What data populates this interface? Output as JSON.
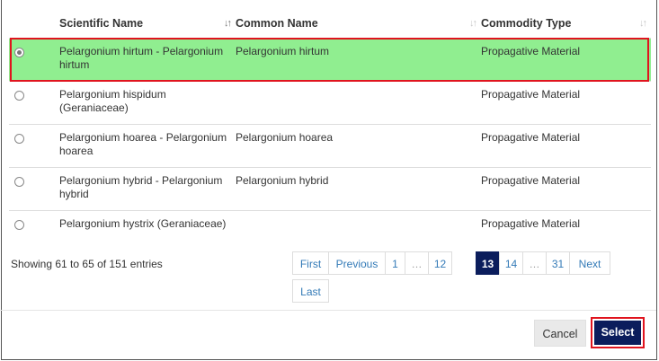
{
  "table": {
    "headers": {
      "scientific_name": "Scientific Name",
      "common_name": "Common Name",
      "commodity_type": "Commodity Type"
    },
    "rows": [
      {
        "scientific": "Pelargonium hirtum - Pelargonium hirtum",
        "common": "Pelargonium hirtum",
        "commodity": "Propagative Material",
        "selected": true
      },
      {
        "scientific": "Pelargonium hispidum (Geraniaceae)",
        "common": "",
        "commodity": "Propagative Material",
        "selected": false
      },
      {
        "scientific": "Pelargonium hoarea - Pelargonium hoarea",
        "common": "Pelargonium hoarea",
        "commodity": "Propagative Material",
        "selected": false
      },
      {
        "scientific": "Pelargonium hybrid - Pelargonium hybrid",
        "common": "Pelargonium hybrid",
        "commodity": "Propagative Material",
        "selected": false
      },
      {
        "scientific": "Pelargonium hystrix (Geraniaceae)",
        "common": "",
        "commodity": "Propagative Material",
        "selected": false
      }
    ]
  },
  "info": "Showing 61 to 65 of 151 entries",
  "pagination": {
    "first": "First",
    "previous": "Previous",
    "pages": [
      "1",
      "…",
      "12",
      "13",
      "14",
      "…",
      "31"
    ],
    "current_page": "13",
    "next": "Next",
    "last": "Last"
  },
  "actions": {
    "cancel": "Cancel",
    "select": "Select"
  },
  "colors": {
    "selected_row": "#90ee90",
    "highlight_outline": "#e0141e",
    "primary": "#0b1d5c",
    "link": "#337ab7"
  }
}
